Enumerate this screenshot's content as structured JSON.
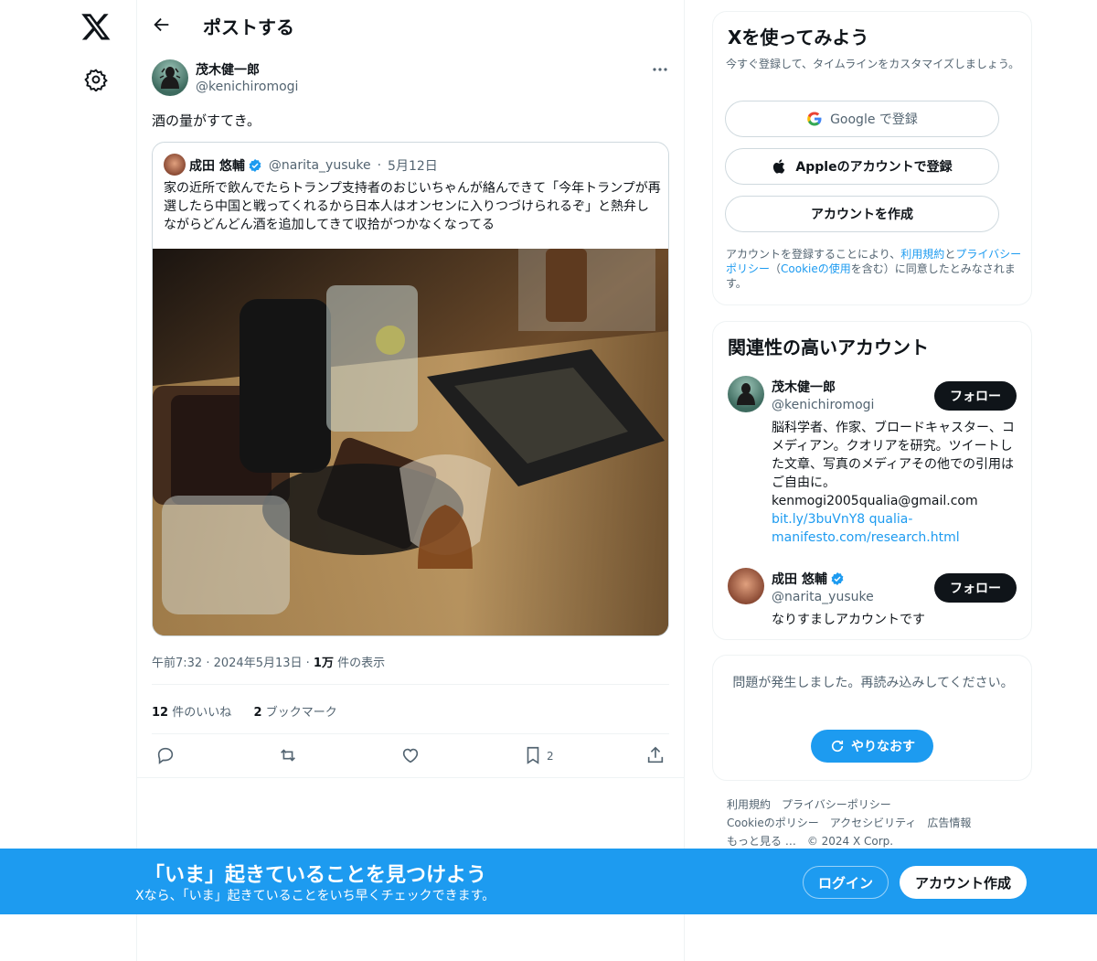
{
  "header": {
    "title": "ポストする"
  },
  "post": {
    "author_name": "茂木健一郎",
    "author_handle": "@kenichiromogi",
    "text": "酒の量がすてき。",
    "meta_time": "午前7:32",
    "meta_date": "2024年5月13日",
    "views_count": "1万",
    "views_label": "件の表示",
    "likes_count": "12",
    "likes_label": "件のいいね",
    "bookmarks_count": "2",
    "bookmarks_label": "ブックマーク",
    "bookmark_action_count": "2"
  },
  "quote": {
    "author_name": "成田 悠輔",
    "author_handle": "@narita_yusuke",
    "date": "5月12日",
    "text": "家の近所で飲んでたらトランプ支持者のおじいちゃんが絡んできて「今年トランプが再選したら中国と戦ってくれるから日本人はオンセンに入りつづけられるぞ」と熱弁しながらどんどん酒を追加してきて収拾がつかなくなってる"
  },
  "signup": {
    "title": "Xを使ってみよう",
    "subtitle": "今すぐ登録して、タイムラインをカスタマイズしましょう。",
    "google": "Google で登録",
    "apple": "Appleのアカウントで登録",
    "create": "アカウントを作成",
    "terms_1": "アカウントを登録することにより、",
    "terms_link_1": "利用規約",
    "terms_2": "と",
    "terms_link_2": "プライバシーポリシー",
    "terms_3": "（",
    "terms_link_3": "Cookieの使用",
    "terms_4": "を含む）に同意したとみなされます。"
  },
  "related": {
    "title": "関連性の高いアカウント",
    "follow_label": "フォロー",
    "accounts": [
      {
        "name": "茂木健一郎",
        "handle": "@kenichiromogi",
        "bio": "脳科学者、作家、ブロードキャスター、コメディアン。クオリアを研究。ツイートした文章、写真のメディアその他での引用はご自由に。",
        "email": "kenmogi2005qualia@gmail.com",
        "links": "bit.ly/3buVnY8 qualia-manifesto.com/research.html"
      },
      {
        "name": "成田 悠輔",
        "handle": "@narita_yusuke",
        "bio": "なりすましアカウントです"
      }
    ]
  },
  "error": {
    "text": "問題が発生しました。再読み込みしてください。",
    "retry": "やりなおす"
  },
  "footer": {
    "terms": "利用規約",
    "privacy": "プライバシーポリシー",
    "cookie": "Cookieのポリシー",
    "accessibility": "アクセシビリティ",
    "ads": "広告情報",
    "more": "もっと見る …",
    "copyright": "© 2024 X Corp."
  },
  "bottom_bar": {
    "title": "「いま」起きていることを見つけよう",
    "subtitle": "Xなら、「いま」起きていることをいち早くチェックできます。",
    "login": "ログイン",
    "signup": "アカウント作成"
  },
  "colors": {
    "accent": "#1d9bf0",
    "text": "#0f1419",
    "muted": "#536471",
    "border": "#eff3f4"
  },
  "icons": [
    "x-logo-icon",
    "settings-icon",
    "back-arrow-icon",
    "more-icon",
    "verified-icon",
    "reply-icon",
    "repost-icon",
    "like-icon",
    "bookmark-icon",
    "share-icon",
    "google-icon",
    "apple-icon",
    "refresh-icon"
  ]
}
